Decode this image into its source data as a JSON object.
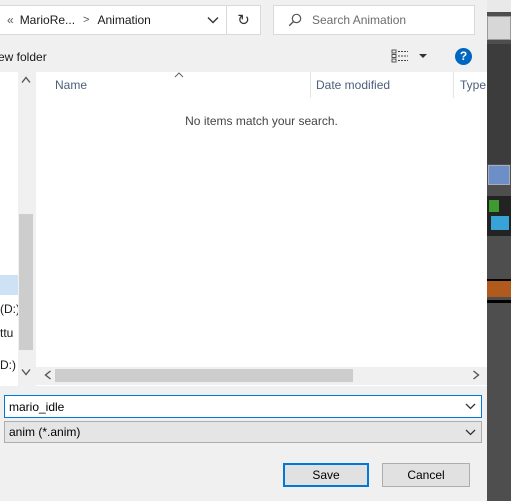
{
  "address_bar": {
    "overflow_chevron": "«",
    "crumbs": [
      "MarioRe...",
      "Animation"
    ],
    "separator": ">",
    "refresh_glyph": "↻"
  },
  "search": {
    "placeholder": "Search Animation"
  },
  "toolbar": {
    "new_folder_label": "ew folder",
    "help_glyph": "?"
  },
  "nav_pane": {
    "items": [
      "(D:)",
      "ttu",
      "D:)"
    ]
  },
  "file_list": {
    "columns": [
      "Name",
      "Date modified",
      "Type"
    ],
    "sort_indicator": "^",
    "empty_message": "No items match your search."
  },
  "file_name": {
    "value": "mario_idle"
  },
  "file_type": {
    "value": "anim (*.anim)"
  },
  "buttons": {
    "save": "Save",
    "cancel": "Cancel"
  },
  "colors": {
    "accent": "#0067c0",
    "focus_border": "#0078d7",
    "dialog_bg": "#f0f0f0",
    "column_header_text": "#4c607a"
  }
}
